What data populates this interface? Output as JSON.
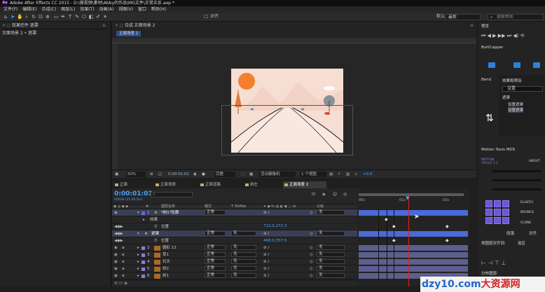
{
  "title": "Adobe After Effects CC 2015 - D:\\做视频\\素材\\Abby的作品\\MG文件\\正常正反.aep *",
  "menu": [
    "文件(F)",
    "编辑(E)",
    "合成(C)",
    "图层(L)",
    "效果(T)",
    "动画(A)",
    "视图(V)",
    "窗口",
    "帮助(H)"
  ],
  "toolbar": {
    "align_label": "对齐",
    "workspace_label": "默认",
    "workspace_value": "最新",
    "search_placeholder": "搜索帮助"
  },
  "left_panel": {
    "tab": "效果控件 遮罩",
    "subtitle": "正面场景 2 • 遮罩"
  },
  "comp_panel": {
    "tab": "合成 正面场景 2",
    "subtab": "正面场景 2"
  },
  "viewer_bar": {
    "zoom": "50%",
    "timecode": "0:00:01:02",
    "resolution": "完整",
    "camera": "活动摄像机",
    "views": "1 个视图",
    "offset": "+0.0"
  },
  "timeline_tabs": [
    {
      "label": "正面",
      "color": "#c9a96e"
    },
    {
      "label": "正面场景",
      "color": "#c9a96e"
    },
    {
      "label": "正面道路",
      "color": "#c9a96e"
    },
    {
      "label": "树左",
      "color": "#c9a96e"
    },
    {
      "label": "正面场景 2",
      "color": "#c9a96e"
    }
  ],
  "timeline": {
    "time": "0:00:01:03",
    "fps": "00028 (25.00 fps)",
    "col_headers": {
      "num": "#",
      "source": "图层名称",
      "mode": "模式",
      "trkmat": "T TrkMat",
      "parent": "父级"
    },
    "ruler": [
      "00s",
      "01s",
      "02s"
    ]
  },
  "layers": [
    {
      "num": "1",
      "name": "*树1\"轮廓",
      "mode": "正常",
      "trk": "",
      "parent": "无",
      "selected": true,
      "color": "#5b6ee0",
      "type": "shape"
    },
    {
      "num": "",
      "name": "效果",
      "mode": "",
      "trk": "",
      "parent": "",
      "selected": false,
      "indent": 1
    },
    {
      "num": "",
      "name": "位置",
      "mode": "",
      "trk": "",
      "parent": "",
      "selected": false,
      "indent": 2
    },
    {
      "num": "",
      "name": "遮罩",
      "mode": "正常",
      "trk": "无",
      "parent": "无",
      "selected": true,
      "indent": 1,
      "value": "712.0,272.3"
    },
    {
      "num": "",
      "name": "位置",
      "mode": "",
      "trk": "",
      "parent": "",
      "selected": false,
      "indent": 2,
      "value": "408.0,357.5"
    },
    {
      "num": "2",
      "name": "圆缸 12",
      "mode": "正常",
      "trk": "无",
      "parent": "无",
      "selected": false,
      "color": "#8a7fd0",
      "type": "precomp"
    },
    {
      "num": "3",
      "name": "草1",
      "mode": "正常",
      "trk": "无",
      "parent": "无",
      "selected": false,
      "color": "#8a7fd0",
      "type": "precomp"
    },
    {
      "num": "4",
      "name": "石头",
      "mode": "正常",
      "trk": "无",
      "parent": "无",
      "selected": false,
      "color": "#8a7fd0",
      "type": "precomp"
    },
    {
      "num": "5",
      "name": "树2",
      "mode": "正常",
      "trk": "无",
      "parent": "无",
      "selected": false,
      "color": "#8a7fd0",
      "type": "precomp"
    },
    {
      "num": "6",
      "name": "树1",
      "mode": "正常",
      "trk": "无",
      "parent": "无",
      "selected": false,
      "color": "#8a7fd0",
      "type": "precomp"
    }
  ],
  "right_panel": {
    "preview_tab": "预览",
    "buttcapper": "ButtCapper",
    "bend": "Bend",
    "effects_tab": "效果和预设",
    "effects_search": "设置",
    "effects_items": [
      "遮罩",
      "设置遮罩",
      "设置遮罩"
    ],
    "motion_tools": "Motion Tools MDS",
    "motion_title": "MOTION TOOLS 1.1",
    "motion_about": "ABOUT",
    "elastic": "ELASTIC",
    "bounce": "BOUNCE",
    "clone": "CLONE",
    "align_tab": "段落",
    "align_tab2": "对齐",
    "align_label": "将图层对齐到:",
    "align_value": "选区",
    "distribute": "分布图层:"
  },
  "watermark": {
    "site": "dzy10.com",
    "brand": "大资源网"
  }
}
